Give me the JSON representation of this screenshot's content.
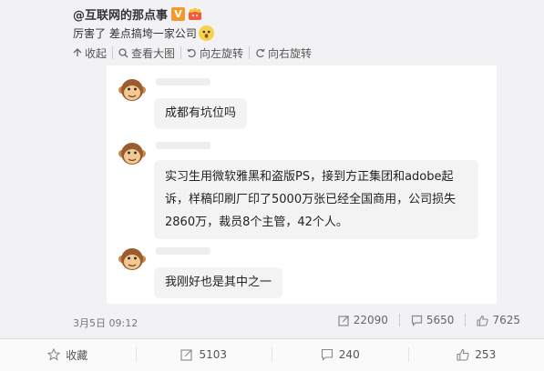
{
  "post": {
    "author": "@互联网的那点事",
    "verified_badge": "V",
    "text": "厉害了 差点搞垮一家公司",
    "toolbar": {
      "collapse": "收起",
      "view_large": "查看大图",
      "rotate_left": "向左旋转",
      "rotate_right": "向右旋转"
    }
  },
  "chat": {
    "messages": [
      "成都有坑位吗",
      "实习生用微软雅黑和盗版PS，接到方正集团和adobe起诉，样稿印刷厂印了5000万张已经全国商用，公司损失2860万，裁员8个主管，42个人。",
      "我刚好也是其中之一"
    ],
    "message_2_lines": [
      "实习生用微软雅黑和盗版PS，接到方正集团和adobe起",
      "诉，样稿印刷厂印了5000万张已经全国商用，公司损失",
      "2860万，裁员8个主管，42个人。"
    ]
  },
  "meta": {
    "date": "3月5日 09:12",
    "reposts": "22090",
    "comments": "5650",
    "likes": "7625"
  },
  "actions": {
    "favorite": "收藏",
    "repost": "5103",
    "comment": "240",
    "like": "253"
  },
  "colors": {
    "accent_badge": "#f09b2c",
    "bubble": "#f3f3f3",
    "card": "#f2f2f5"
  }
}
